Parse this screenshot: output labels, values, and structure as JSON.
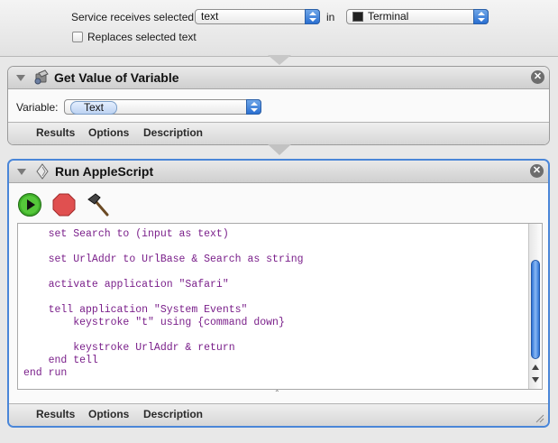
{
  "service": {
    "receives_label": "Service receives selected",
    "input_type": "text",
    "in_label": "in",
    "application": "Terminal",
    "replaces_label": "Replaces selected text",
    "replaces_checked": false
  },
  "get_variable_action": {
    "title": "Get Value of Variable",
    "variable_label": "Variable:",
    "variable_value": "Text",
    "tabs": [
      "Results",
      "Options",
      "Description"
    ]
  },
  "applescript_action": {
    "title": "Run AppleScript",
    "code_lines": [
      "    set Search to (input as text)",
      "",
      "    set UrlAddr to UrlBase & Search as string",
      "",
      "    activate application \"Safari\"",
      "",
      "    tell application \"System Events\"",
      "        keystroke \"t\" using {command down}",
      "",
      "        keystroke UrlAddr & return",
      "    end tell",
      "end run"
    ],
    "tabs": [
      "Results",
      "Options",
      "Description"
    ]
  },
  "icons": {
    "run": "run-button-icon",
    "stop": "stop-button-icon",
    "compile": "hammer-icon",
    "close": "close-icon",
    "disclosure": "disclosure-triangle-icon"
  },
  "colors": {
    "selection_border": "#4a86d8",
    "code_text": "#7a1f8a",
    "run_green": "#3fae2a",
    "stop_red": "#e05050"
  }
}
